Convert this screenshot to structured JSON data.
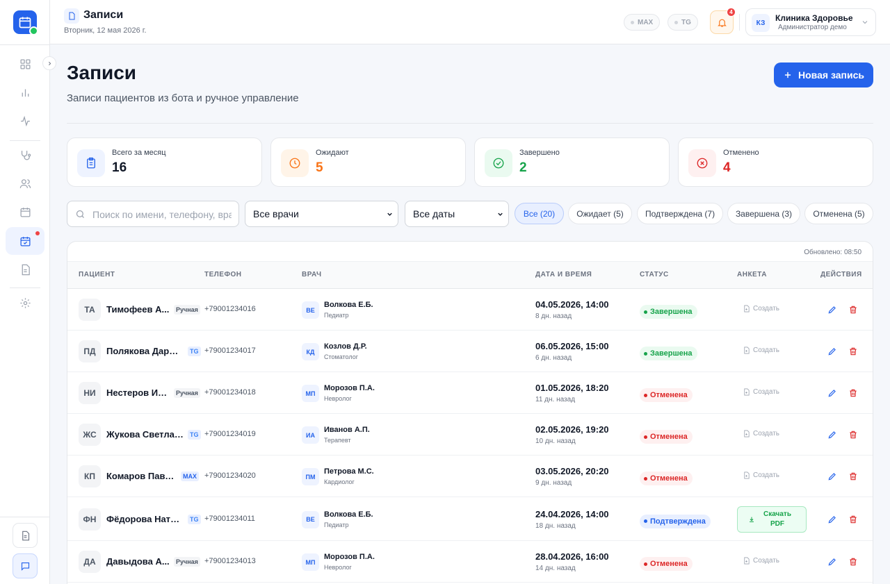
{
  "topbar": {
    "title": "Записи",
    "date": "Вторник, 12 мая 2026 г.",
    "channels": [
      "MAX",
      "TG"
    ],
    "notifications": "4",
    "clinic": {
      "initials": "КЗ",
      "name": "Клиника Здоровье",
      "role": "Администратор демо"
    }
  },
  "page": {
    "title": "Записи",
    "subtitle": "Записи пациентов из бота и ручное управление",
    "new_button": "Новая запись"
  },
  "stats": [
    {
      "label": "Всего за месяц",
      "value": "16",
      "color": "#111827",
      "icon_bg": "#eef3ff",
      "icon_color": "#2563eb",
      "icon": "clipboard-icon"
    },
    {
      "label": "Ожидают",
      "value": "5",
      "color": "#f97316",
      "icon_bg": "#fff4e8",
      "icon_color": "#f97316",
      "icon": "clock-icon"
    },
    {
      "label": "Завершено",
      "value": "2",
      "color": "#16a34a",
      "icon_bg": "#eafaf0",
      "icon_color": "#16a34a",
      "icon": "check-circle-icon"
    },
    {
      "label": "Отменено",
      "value": "4",
      "color": "#dc2626",
      "icon_bg": "#fef0f0",
      "icon_color": "#dc2626",
      "icon": "x-circle-icon"
    }
  ],
  "filters": {
    "search_placeholder": "Поиск по имени, телефону, врачу",
    "doctor_select": "Все врачи",
    "date_select": "Все даты",
    "chips": [
      "Все (20)",
      "Ожидает (5)",
      "Подтверждена (7)",
      "Завершена (3)",
      "Отменена (5)"
    ],
    "active_chip": 0
  },
  "table": {
    "updated": "Обновлено: 08:50",
    "headers": [
      "ПАЦИЕНТ",
      "ТЕЛЕФОН",
      "ВРАЧ",
      "ДАТА И ВРЕМЯ",
      "СТАТУС",
      "АНКЕТА",
      "ДЕЙСТВИЯ"
    ],
    "create_label": "Создать",
    "pdf_label": "Скачать PDF",
    "rows": [
      {
        "initials": "ТА",
        "name": "Тимофеев А...",
        "source": "Ручная",
        "phone": "+79001234016",
        "doctor_initials": "ВЕ",
        "doctor": "Волкова Е.Б.",
        "specialty": "Педиатр",
        "datetime": "04.05.2026, 14:00",
        "ago": "8 дн. назад",
        "status": "Завершена",
        "status_type": "done",
        "form": "create"
      },
      {
        "initials": "ПД",
        "name": "Полякова Дарья...",
        "source": "TG",
        "phone": "+79001234017",
        "doctor_initials": "КД",
        "doctor": "Козлов Д.Р.",
        "specialty": "Стоматолог",
        "datetime": "06.05.2026, 15:00",
        "ago": "6 дн. назад",
        "status": "Завершена",
        "status_type": "done",
        "form": "create"
      },
      {
        "initials": "НИ",
        "name": "Нестеров Ил...",
        "source": "Ручная",
        "phone": "+79001234018",
        "doctor_initials": "МП",
        "doctor": "Морозов П.А.",
        "specialty": "Невролог",
        "datetime": "01.05.2026, 18:20",
        "ago": "11 дн. назад",
        "status": "Отменена",
        "status_type": "cancel",
        "form": "create"
      },
      {
        "initials": "ЖС",
        "name": "Жукова Светлан...",
        "source": "TG",
        "phone": "+79001234019",
        "doctor_initials": "ИА",
        "doctor": "Иванов А.П.",
        "specialty": "Терапевт",
        "datetime": "02.05.2026, 19:20",
        "ago": "10 дн. назад",
        "status": "Отменена",
        "status_type": "cancel",
        "form": "create"
      },
      {
        "initials": "КП",
        "name": "Комаров Паве...",
        "source": "MAX",
        "phone": "+79001234020",
        "doctor_initials": "ПМ",
        "doctor": "Петрова М.С.",
        "specialty": "Кардиолог",
        "datetime": "03.05.2026, 20:20",
        "ago": "9 дн. назад",
        "status": "Отменена",
        "status_type": "cancel",
        "form": "create"
      },
      {
        "initials": "ФН",
        "name": "Фёдорова Натал...",
        "source": "TG",
        "phone": "+79001234011",
        "doctor_initials": "ВЕ",
        "doctor": "Волкова Е.Б.",
        "specialty": "Педиатр",
        "datetime": "24.04.2026, 14:00",
        "ago": "18 дн. назад",
        "status": "Подтверждена",
        "status_type": "conf",
        "form": "pdf"
      },
      {
        "initials": "ДА",
        "name": "Давыдова А...",
        "source": "Ручная",
        "phone": "+79001234013",
        "doctor_initials": "МП",
        "doctor": "Морозов П.А.",
        "specialty": "Невролог",
        "datetime": "28.04.2026, 16:00",
        "ago": "14 дн. назад",
        "status": "Отменена",
        "status_type": "cancel",
        "form": "create"
      }
    ]
  }
}
